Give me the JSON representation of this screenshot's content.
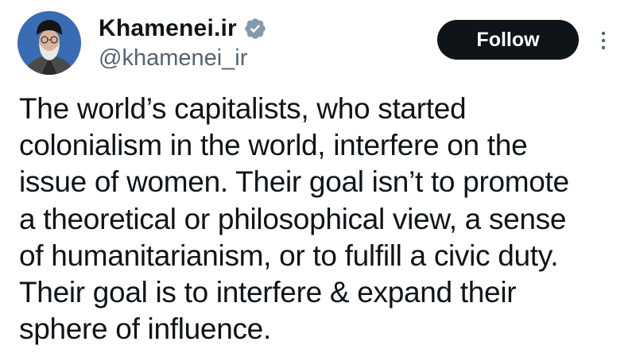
{
  "author": {
    "display_name": "Khamenei.ir",
    "handle": "@khamenei_ir"
  },
  "icons": {
    "verified": "verified-badge-icon",
    "more": "more-options-icon",
    "avatar": "profile-photo"
  },
  "colors": {
    "text": "#0f1419",
    "secondary_text": "#536471",
    "follow_bg": "#0f1419",
    "follow_text": "#ffffff",
    "verified_badge": "#829aab"
  },
  "actions": {
    "follow_label": "Follow"
  },
  "tweet": {
    "text": "The world’s capitalists, who started\ncolonialism in the world, interfere on the\nissue of women. Their goal isn’t to promote\na theoretical or philosophical view, a sense\nof humanitarianism, or to fulfill a civic duty.\nTheir goal is to interfere & expand their\nsphere of influence."
  }
}
